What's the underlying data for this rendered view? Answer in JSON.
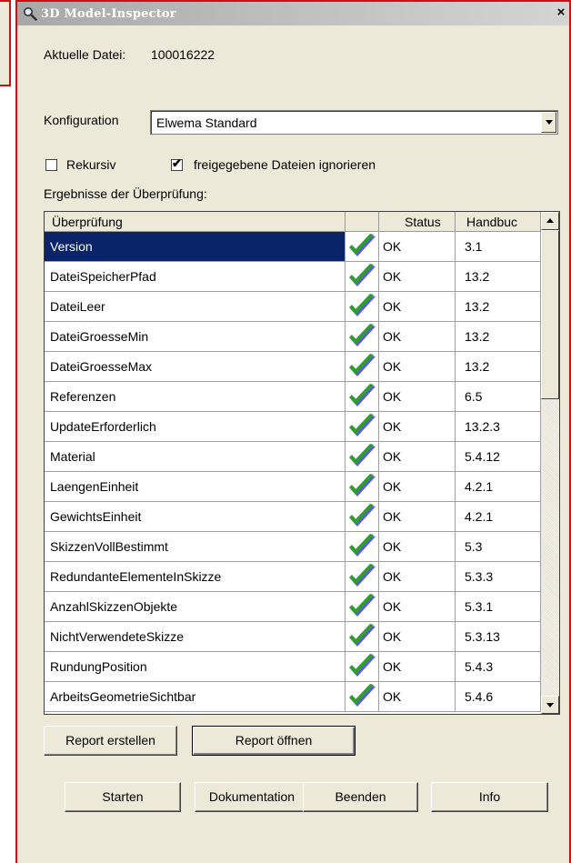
{
  "window": {
    "title": "3D Model-Inspector",
    "close_glyph": "×"
  },
  "file": {
    "label": "Aktuelle Datei:",
    "value": "100016222"
  },
  "config": {
    "label": "Konfiguration",
    "selected": "Elwema Standard"
  },
  "options": {
    "recursive": {
      "label": "Rekursiv",
      "checked": false
    },
    "ignore_released": {
      "label": "freigegebene Dateien ignorieren",
      "checked": true,
      "mark": "✔"
    }
  },
  "results": {
    "label": "Ergebnisse der Überprüfung:",
    "columns": {
      "check": "Überprüfung",
      "status": "Status",
      "manual": "Handbuc"
    },
    "rows": [
      {
        "name": "Version",
        "status": "OK",
        "manual": "3.1"
      },
      {
        "name": "DateiSpeicherPfad",
        "status": "OK",
        "manual": "13.2"
      },
      {
        "name": "DateiLeer",
        "status": "OK",
        "manual": "13.2"
      },
      {
        "name": "DateiGroesseMin",
        "status": "OK",
        "manual": "13.2"
      },
      {
        "name": "DateiGroesseMax",
        "status": "OK",
        "manual": "13.2"
      },
      {
        "name": "Referenzen",
        "status": "OK",
        "manual": "6.5"
      },
      {
        "name": "UpdateErforderlich",
        "status": "OK",
        "manual": "13.2.3"
      },
      {
        "name": "Material",
        "status": "OK",
        "manual": "5.4.12"
      },
      {
        "name": "LaengenEinheit",
        "status": "OK",
        "manual": "4.2.1"
      },
      {
        "name": "GewichtsEinheit",
        "status": "OK",
        "manual": "4.2.1"
      },
      {
        "name": "SkizzenVollBestimmt",
        "status": "OK",
        "manual": "5.3"
      },
      {
        "name": "RedundanteElementeInSkizze",
        "status": "OK",
        "manual": "5.3.3"
      },
      {
        "name": "AnzahlSkizzenObjekte",
        "status": "OK",
        "manual": "5.3.1"
      },
      {
        "name": "NichtVerwendeteSkizze",
        "status": "OK",
        "manual": "5.3.13"
      },
      {
        "name": "RundungPosition",
        "status": "OK",
        "manual": "5.4.3"
      },
      {
        "name": "ArbeitsGeometrieSichtbar",
        "status": "OK",
        "manual": "5.4.6"
      }
    ]
  },
  "buttons": {
    "report_create": "Report erstellen",
    "report_open": "Report öffnen",
    "start": "Starten",
    "docs": "Dokumentation",
    "quit": "Beenden",
    "info": "Info"
  },
  "colors": {
    "selection": "#0a246a",
    "check_green": "#2e9e2e",
    "check_blue": "#5b5bd6",
    "frame_red": "#cc1111"
  },
  "icons": {
    "title": "magnifier-icon",
    "status_ok": "green-check-icon"
  }
}
